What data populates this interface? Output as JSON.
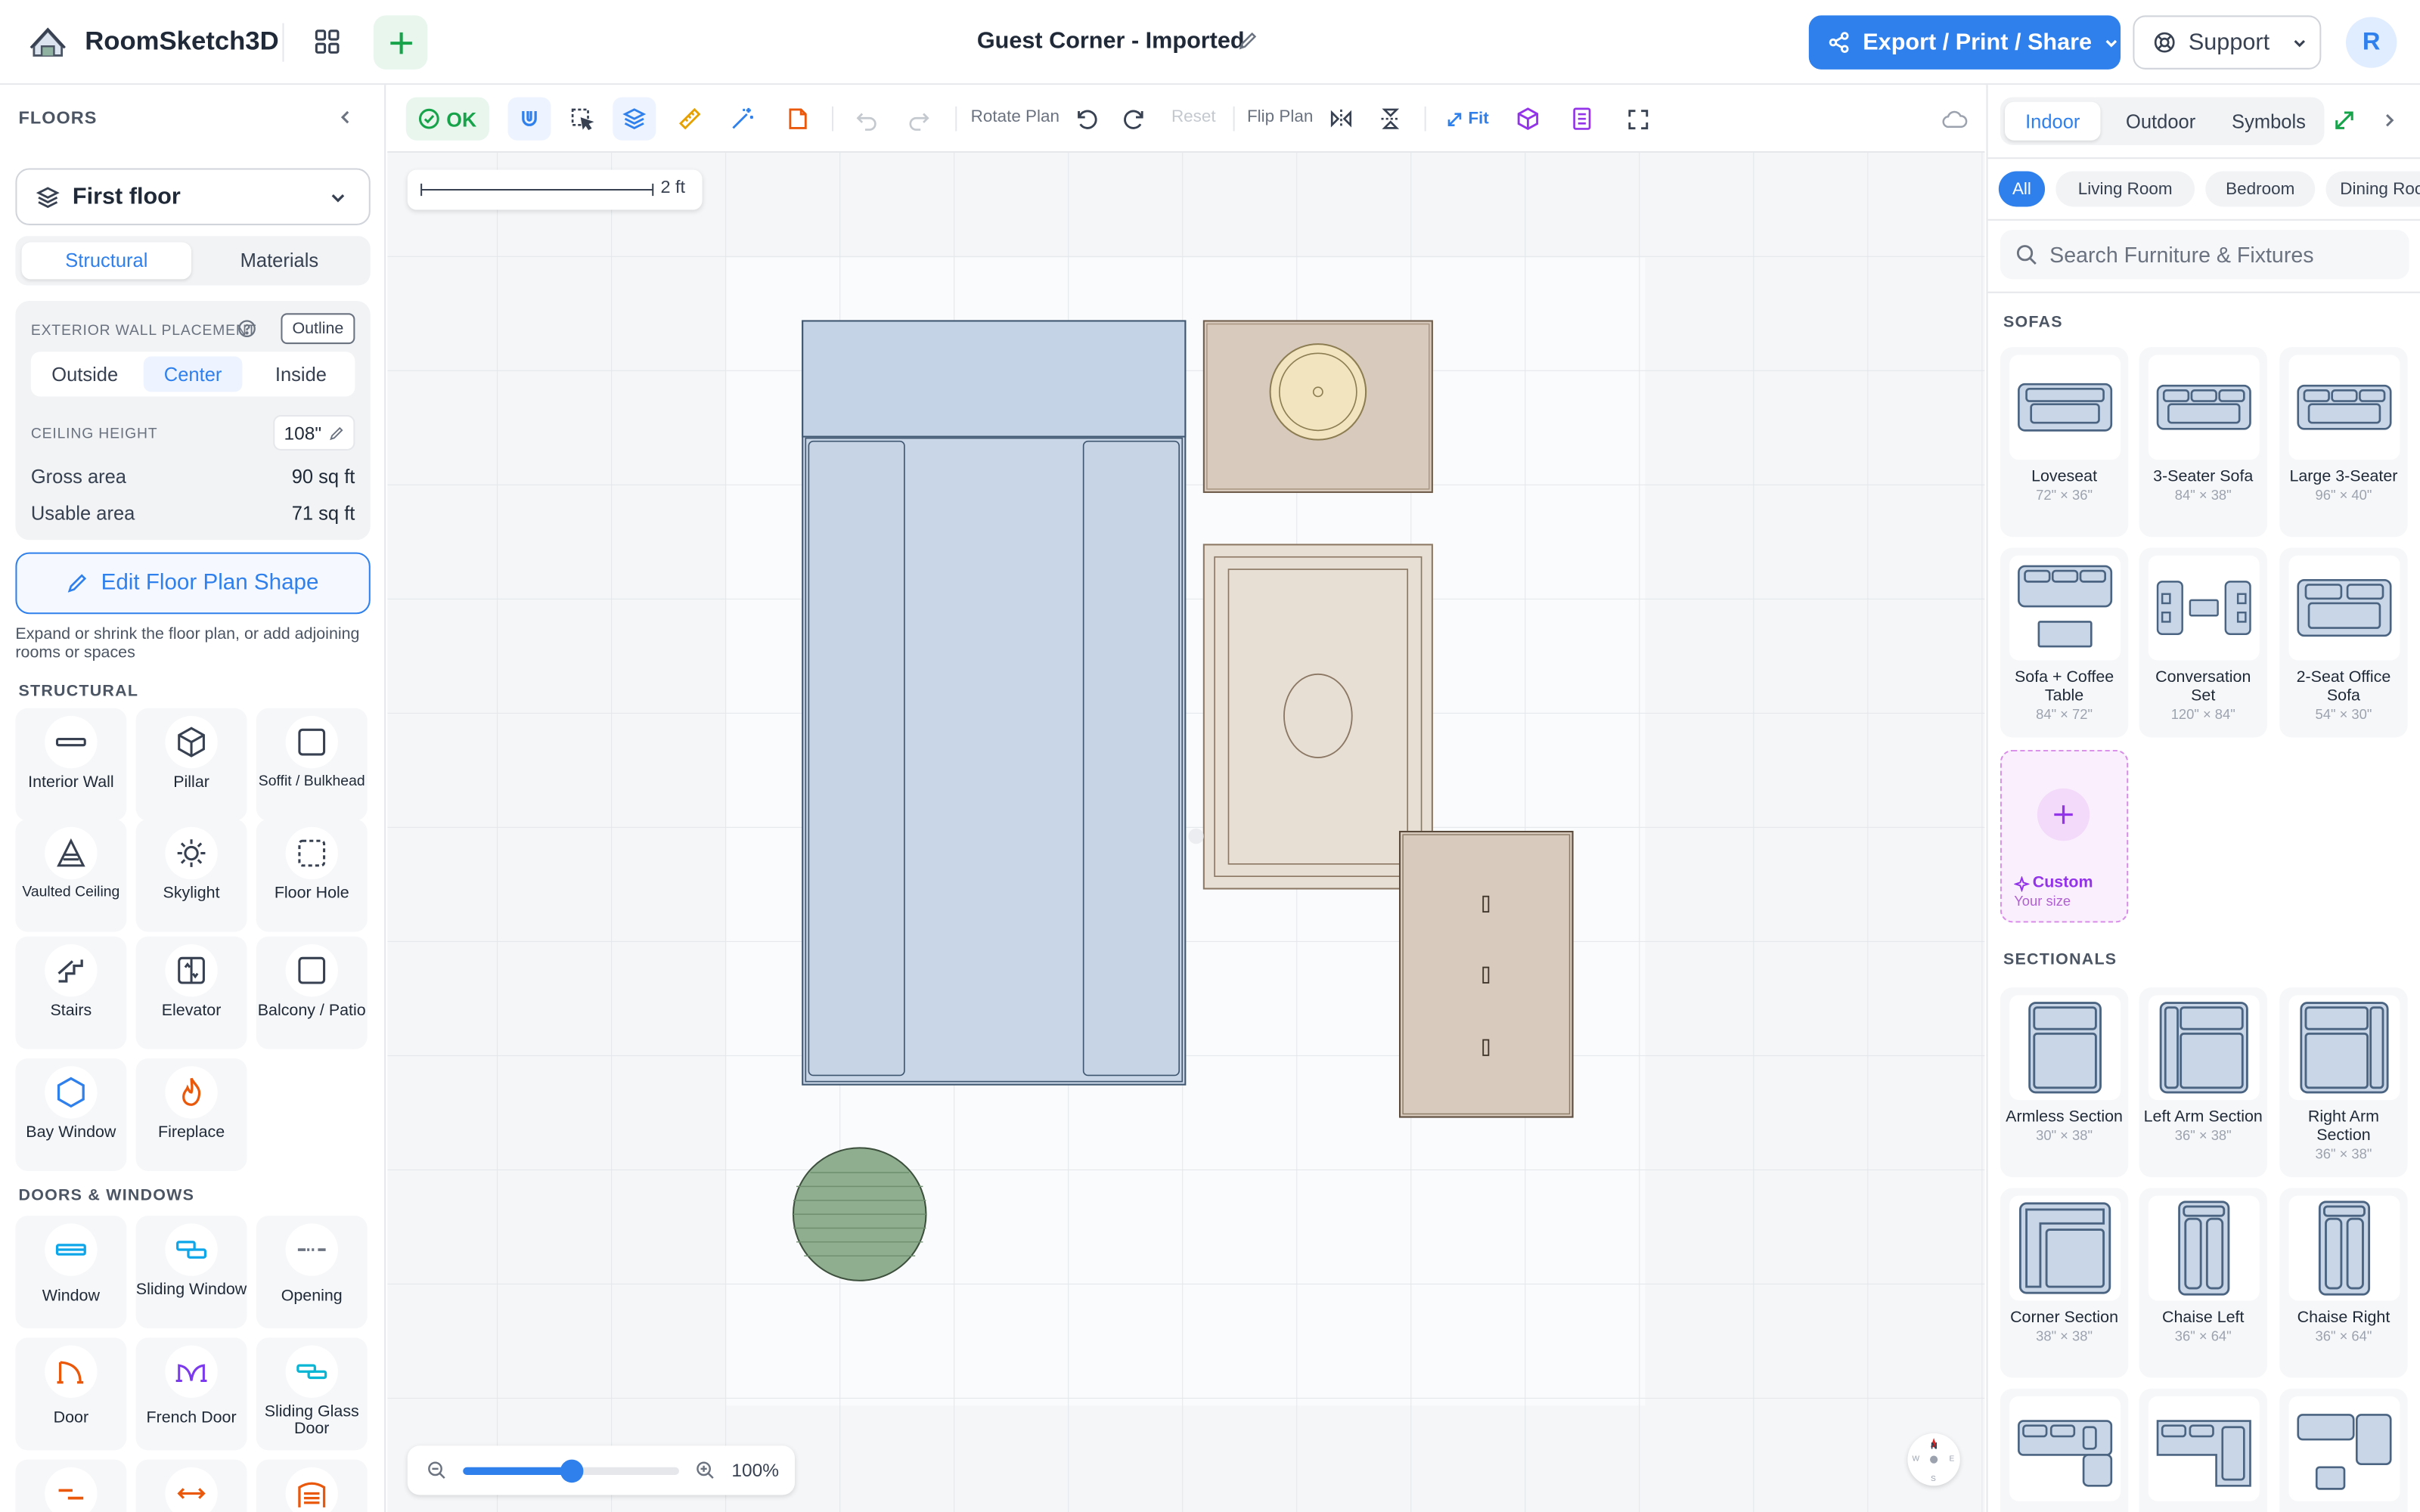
{
  "app": {
    "name": "RoomSketch3D",
    "document_title": "Guest Corner - Imported",
    "user_initial": "R"
  },
  "header": {
    "export_label": "Export / Print / Share",
    "support_label": "Support"
  },
  "sidebar": {
    "title": "FLOORS",
    "floor_name": "First floor",
    "tabs": [
      "Structural",
      "Materials"
    ],
    "active_tab": "Structural",
    "wall_placement_label": "EXTERIOR WALL PLACEMENT",
    "outline_label": "Outline",
    "wall_placement_options": [
      "Outside",
      "Center",
      "Inside"
    ],
    "wall_placement_active": "Center",
    "ceiling_label": "CEILING HEIGHT",
    "ceiling_value": "108\"",
    "gross_area_label": "Gross area",
    "gross_area_value": "90 sq ft",
    "usable_area_label": "Usable area",
    "usable_area_value": "71 sq ft",
    "edit_shape_label": "Edit Floor Plan Shape",
    "edit_shape_hint": "Expand or shrink the floor plan, or add adjoining rooms or spaces",
    "structural_heading": "STRUCTURAL",
    "structural_items": [
      {
        "label": "Interior Wall",
        "icon": "interior-wall-icon"
      },
      {
        "label": "Pillar",
        "icon": "pillar-icon"
      },
      {
        "label": "Soffit / Bulkhead",
        "icon": "soffit-icon"
      },
      {
        "label": "Vaulted Ceiling",
        "icon": "vaulted-ceiling-icon"
      },
      {
        "label": "Skylight",
        "icon": "skylight-icon"
      },
      {
        "label": "Floor Hole",
        "icon": "floor-hole-icon"
      },
      {
        "label": "Stairs",
        "icon": "stairs-icon"
      },
      {
        "label": "Elevator",
        "icon": "elevator-icon"
      },
      {
        "label": "Balcony / Patio",
        "icon": "balcony-icon"
      },
      {
        "label": "Bay Window",
        "icon": "bay-window-icon"
      },
      {
        "label": "Fireplace",
        "icon": "fireplace-icon"
      }
    ],
    "doors_heading": "DOORS & WINDOWS",
    "door_items": [
      {
        "label": "Window",
        "icon": "window-icon"
      },
      {
        "label": "Sliding Window",
        "icon": "sliding-window-icon"
      },
      {
        "label": "Opening",
        "icon": "opening-icon"
      },
      {
        "label": "Door",
        "icon": "door-icon"
      },
      {
        "label": "French Door",
        "icon": "french-door-icon"
      },
      {
        "label": "Sliding Glass Door",
        "icon": "sliding-glass-door-icon"
      }
    ]
  },
  "toolbar": {
    "ok_label": "OK",
    "rotate_label": "Rotate Plan",
    "reset_label": "Reset",
    "flip_label": "Flip Plan",
    "fit_label": "Fit"
  },
  "canvas": {
    "scale_label": "2 ft",
    "zoom_percent": "100%",
    "zoom_level": 0.5,
    "compass_labels": [
      "N",
      "E",
      "S",
      "W"
    ]
  },
  "library": {
    "tabs": [
      "Indoor",
      "Outdoor",
      "Symbols"
    ],
    "active_tab": "Indoor",
    "categories": [
      "All",
      "Living Room",
      "Bedroom",
      "Dining Room"
    ],
    "active_category": "All",
    "search_placeholder": "Search Furniture & Fixtures",
    "sofas_heading": "SOFAS",
    "sofas": [
      {
        "name": "Loveseat",
        "dims": "72\" × 36\""
      },
      {
        "name": "3-Seater Sofa",
        "dims": "84\" × 38\""
      },
      {
        "name": "Large 3-Seater",
        "dims": "96\" × 40\""
      },
      {
        "name": "Sofa + Coffee Table",
        "dims": "84\" × 72\""
      },
      {
        "name": "Conversation Set",
        "dims": "120\" × 84\""
      },
      {
        "name": "2-Seat Office Sofa",
        "dims": "54\" × 30\""
      }
    ],
    "custom": {
      "name": "Custom",
      "sub": "Your size"
    },
    "sectionals_heading": "SECTIONALS",
    "sectionals": [
      {
        "name": "Armless Section",
        "dims": "30\" × 38\""
      },
      {
        "name": "Left Arm Section",
        "dims": "36\" × 38\""
      },
      {
        "name": "Right Arm Section",
        "dims": "36\" × 38\""
      },
      {
        "name": "Corner Section",
        "dims": "38\" × 38\""
      },
      {
        "name": "Chaise Left",
        "dims": "36\" × 64\""
      },
      {
        "name": "Chaise Right",
        "dims": "36\" × 64\""
      }
    ]
  },
  "colors": {
    "accent": "#2f80ed",
    "ok_green": "#16a34a",
    "custom_purple": "#9333ea",
    "sofa_blue": "#c9d6e7",
    "wood": "#d8cbbd",
    "plant_green": "#8fae8f"
  }
}
